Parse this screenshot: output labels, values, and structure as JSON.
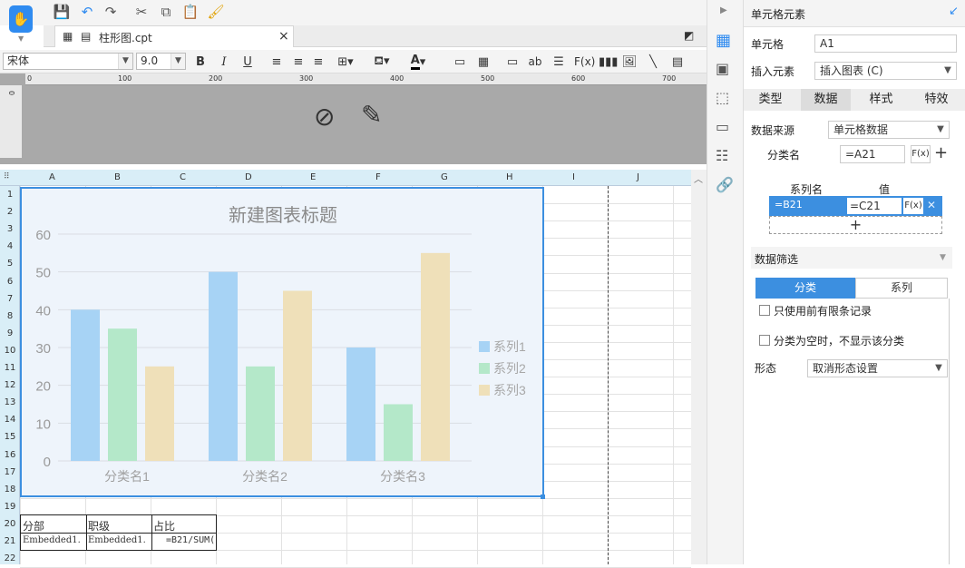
{
  "colors": {
    "accent": "#3c8fe0",
    "series1": "#a7d3f5",
    "series2": "#b4e8c9",
    "series3": "#efe0b9"
  },
  "file_tab": {
    "name": "柱形图.cpt",
    "close": "×"
  },
  "toolbar": {
    "font_name": "宋体",
    "font_size": "9.0",
    "bold": "B",
    "italic": "I",
    "underline": "U",
    "formula": "F(x)",
    "ab": "ab"
  },
  "ruler": {
    "h_ticks": [
      "0",
      "100",
      "200",
      "300",
      "400",
      "500",
      "600",
      "700"
    ],
    "v_tick": "0"
  },
  "sheet": {
    "columns": [
      "A",
      "B",
      "C",
      "D",
      "E",
      "F",
      "G",
      "H",
      "I",
      "J"
    ],
    "rows": [
      "1",
      "2",
      "3",
      "4",
      "5",
      "6",
      "7",
      "8",
      "9",
      "10",
      "11",
      "12",
      "13",
      "14",
      "15",
      "16",
      "17",
      "18",
      "19",
      "20",
      "21",
      "22"
    ],
    "cells": {
      "A20": "分部",
      "B20": "职级",
      "C20": "占比",
      "A21": "Embedded1.",
      "B21": "Embedded1.",
      "C21": "=B21/SUM("
    }
  },
  "chart_data": {
    "type": "bar",
    "title": "新建图表标题",
    "categories": [
      "分类名1",
      "分类名2",
      "分类名3"
    ],
    "series": [
      {
        "name": "系列1",
        "values": [
          40,
          50,
          30
        ]
      },
      {
        "name": "系列2",
        "values": [
          35,
          25,
          15
        ]
      },
      {
        "name": "系列3",
        "values": [
          25,
          45,
          55
        ]
      }
    ],
    "yticks": [
      "0",
      "10",
      "20",
      "30",
      "40",
      "50",
      "60"
    ],
    "ylim": [
      0,
      60
    ],
    "legend": "right"
  },
  "panel": {
    "title": "单元格元素",
    "cell_label": "单元格",
    "cell_value": "A1",
    "insert_label": "插入元素",
    "insert_value": "插入图表 (C)",
    "tabs": [
      "类型",
      "数据",
      "样式",
      "特效"
    ],
    "source_label": "数据来源",
    "source_value": "单元格数据",
    "category_label": "分类名",
    "category_value": "=A21",
    "fx": "F(x)",
    "series_header": "系列名",
    "value_header": "值",
    "series_row_name": "=B21",
    "series_row_value": "=C21",
    "add": "+",
    "filter_label": "数据筛选",
    "filter_tabs": [
      "分类",
      "系列"
    ],
    "check1": "只使用前有限条记录",
    "check2": "分类为空时，不显示该分类",
    "form_label": "形态",
    "form_value": "取消形态设置"
  }
}
